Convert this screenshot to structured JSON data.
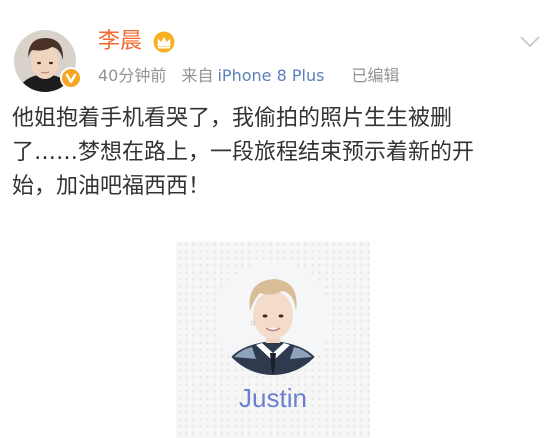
{
  "user": {
    "name": "李晨",
    "avatar_icon": "user-avatar",
    "verified_icon": "verified-v-badge",
    "crown_icon": "crown-icon",
    "name_color": "#f2682d"
  },
  "meta": {
    "time": "40分钟前",
    "source_prefix": "来自",
    "device": "iPhone 8 Plus",
    "edited": "已编辑"
  },
  "menu": {
    "icon": "chevron-down-icon"
  },
  "post": {
    "lines": [
      "他姐抱着手机看哭了，我偷拍的照片生生被删",
      "了……梦想在路上，一段旅程结束预示着新的开",
      "始，加油吧福西西！"
    ]
  },
  "image_card": {
    "name": "Justin",
    "name_color": "#6a7fd0",
    "avatar_icon": "justin-portrait"
  }
}
